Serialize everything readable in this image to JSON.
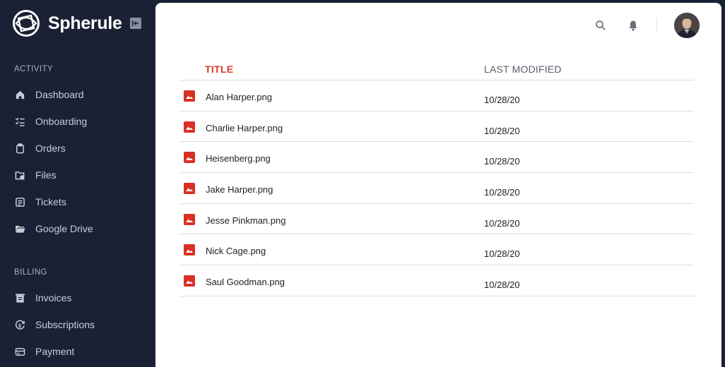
{
  "brand": {
    "name": "Spherule"
  },
  "sidebar": {
    "sections": [
      {
        "label": "ACTIVITY",
        "items": [
          {
            "label": "Dashboard",
            "icon": "home-icon"
          },
          {
            "label": "Onboarding",
            "icon": "checklist-icon"
          },
          {
            "label": "Orders",
            "icon": "clipboard-icon"
          },
          {
            "label": "Files",
            "icon": "folder-file-icon"
          },
          {
            "label": "Tickets",
            "icon": "ticket-icon"
          },
          {
            "label": "Google Drive",
            "icon": "folder-open-icon"
          }
        ]
      },
      {
        "label": "BILLING",
        "items": [
          {
            "label": "Invoices",
            "icon": "invoice-icon"
          },
          {
            "label": "Subscriptions",
            "icon": "subscription-icon"
          },
          {
            "label": "Payment",
            "icon": "credit-card-icon"
          }
        ]
      }
    ]
  },
  "table": {
    "columns": {
      "title": "TITLE",
      "last_modified": "LAST MODIFIED"
    },
    "rows": [
      {
        "name": "Alan Harper.png",
        "modified": "10/28/20"
      },
      {
        "name": "Charlie Harper.png",
        "modified": "10/28/20"
      },
      {
        "name": "Heisenberg.png",
        "modified": "10/28/20"
      },
      {
        "name": "Jake Harper.png",
        "modified": "10/28/20"
      },
      {
        "name": "Jesse Pinkman.png",
        "modified": "10/28/20"
      },
      {
        "name": "Nick Cage.png",
        "modified": "10/28/20"
      },
      {
        "name": "Saul Goodman.png",
        "modified": "10/28/20"
      }
    ]
  },
  "colors": {
    "sidebar_bg": "#1b2134",
    "accent": "#d63a2b",
    "file_icon": "#d93025"
  }
}
